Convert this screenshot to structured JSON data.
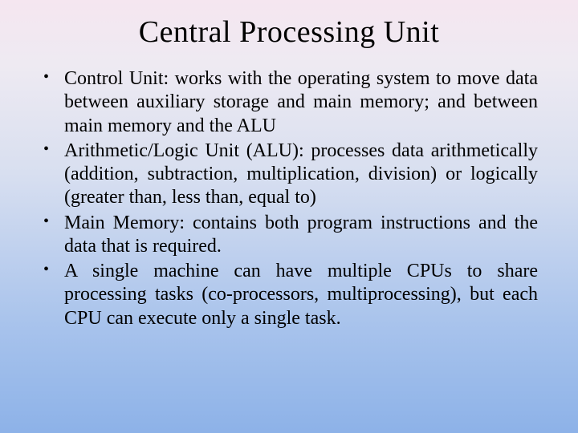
{
  "title": "Central Processing Unit",
  "bullets": [
    "Control Unit: works with the operating system to move data between auxiliary storage and main memory; and between main memory and the ALU",
    "Arithmetic/Logic Unit (ALU): processes data arithmetically (addition, subtraction, multiplication, division) or logically (greater than, less than, equal to)",
    "Main Memory: contains both program instructions and the data that is required.",
    "A single machine can have  multiple CPUs to share processing tasks (co-processors, multiprocessing), but each CPU can execute only a single task."
  ]
}
